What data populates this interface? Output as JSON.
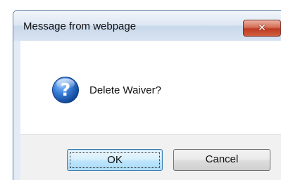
{
  "dialog": {
    "title": "Message from webpage",
    "close_symbol": "✕",
    "message": "Delete Waiver?",
    "icon": "question-icon",
    "buttons": {
      "ok_label": "OK",
      "cancel_label": "Cancel"
    }
  },
  "colors": {
    "close_button": "#c9452b",
    "ok_border": "#3c7fb1",
    "icon_blue": "#1f5fb5"
  }
}
